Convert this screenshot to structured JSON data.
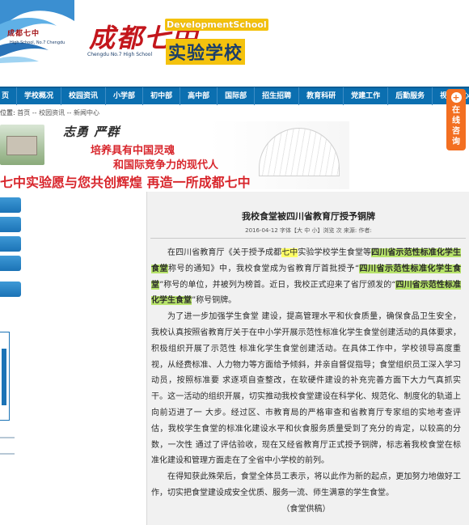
{
  "header": {
    "logo_text": "成都七中",
    "logo_subtext": "High School, No.7 Chengdu",
    "school_name": "成都七中",
    "school_sub": "Chengdu No.7 High School",
    "dev_school": "DevelopmentSchool",
    "shiyan": "实验学校"
  },
  "nav": {
    "items": [
      "页",
      "学校概况",
      "校园资讯",
      "小学部",
      "初中部",
      "高中部",
      "国际部",
      "招生招聘",
      "教育科研",
      "党建工作",
      "后勤服务",
      "视频中心"
    ]
  },
  "breadcrumb": {
    "label": "位置:",
    "path": "首页 -- 校园资讯 -- 新闻中心"
  },
  "banner": {
    "motto": "志勇 严群",
    "line1": "培养具有中国灵魂",
    "line2": "和国际竞争力的现代人",
    "slogan": "七中实验愿与您共创辉煌 再造一所成都七中"
  },
  "side_float": {
    "plus": "+",
    "chars": [
      "在",
      "线",
      "咨",
      "询"
    ]
  },
  "article": {
    "title": "我校食堂被四川省教育厅授予铜牌",
    "meta": "2016-04-12 字体【大 中 小】浏览 次 来源: 作者:",
    "p1_a": "在四川省教育厅《关于授予成都",
    "p1_hl_y": "七中",
    "p1_b": "实验学校学生食堂等",
    "p1_hl_g1": "四川省示范性标准化学生食堂",
    "p1_c": "称号的通知》中，我校食堂成为省教育厅首批授予“",
    "p1_hl_g2": "四川省示范性标准化学生食堂",
    "p1_d": "”称号的单位，并被列为榜首。近日，我校正式迎来了省厅颁发的“",
    "p1_hl_g3": "四川省示范性标准化学生食堂",
    "p1_e": "”称号铜牌。",
    "p2": "为了进一步加强学生食堂 建设，提高管理水平和伙食质量，确保食品卫生安全，我校认真按照省教育厅关于在中小学开展示范性标准化学生食堂创建活动的具体要求，积极组织开展了示范性 标准化学生食堂创建活动。在具体工作中，学校领导高度重视，从经费标准、人力物力等方面给予倾斜，并亲自督促指导；食堂组织员工深入学习动员，按照标准要 求逐项自查整改，在软硬件建设的补充完善方面下大力气真抓实干。这一活动的组织开展，切实推动我校食堂建设在科学化、规范化、制度化的轨道上向前迈进了一 大步。经过区、市教育局的严格审查和省教育厅专家组的实地考查评估，我校学生食堂的标准化建设水平和伙食服务质量受到了充分的肯定，以较高的分数，一次性 通过了评估验收，现在又经省教育厅正式授予铜牌，标志着我校食堂在标准化建设和管理方面走在了全省中小学校的前列。",
    "p3": "在得知获此殊荣后，食堂全体员工表示，将以此作为新的起点，更加努力地做好工作，切实把食堂建设成安全优质、服务一流、师生满意的学生食堂。",
    "sign": "（食堂供稿）"
  },
  "colors": {
    "nav_bg": "#0b6fb0",
    "accent_red": "#d8262c",
    "highlight_yellow": "#ffff66",
    "highlight_green": "#b7e36a",
    "float_orange": "#f36f21"
  }
}
